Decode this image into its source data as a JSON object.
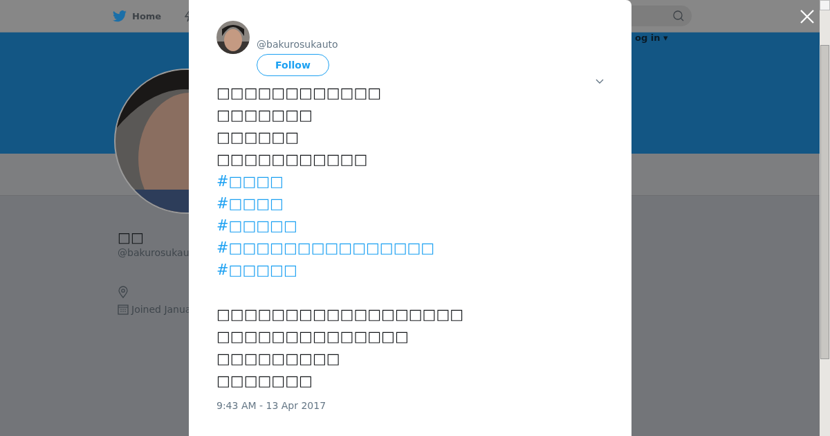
{
  "background_page": {
    "nav": {
      "home": "Home",
      "login": "og in ▾"
    },
    "profile": {
      "name": "□□",
      "handle": "@bakurosukau",
      "joined": "Joined Janua"
    }
  },
  "tweet_modal": {
    "author": {
      "handle": "@bakurosukauto",
      "follow": "Follow"
    },
    "lines": [
      {
        "kind": "text",
        "text": "□□□□□□□□□□□□"
      },
      {
        "kind": "text",
        "text": "□□□□□□□"
      },
      {
        "kind": "text",
        "text": "□□□□□□"
      },
      {
        "kind": "text",
        "text": "□□□□□□□□□□□"
      },
      {
        "kind": "hashtag",
        "text": "#□□□□"
      },
      {
        "kind": "hashtag",
        "text": "#□□□□"
      },
      {
        "kind": "hashtag",
        "text": "#□□□□□"
      },
      {
        "kind": "hashtag",
        "text": "#□□□□□□□□□□□□□□□"
      },
      {
        "kind": "hashtag",
        "text": "#□□□□□"
      },
      {
        "kind": "blank"
      },
      {
        "kind": "text",
        "text": "□□□□□□□□□□□□□□□□□□"
      },
      {
        "kind": "text",
        "text": "□□□□□□□□□□□□□□"
      },
      {
        "kind": "text",
        "text": "□□□□□□□□□"
      },
      {
        "kind": "text",
        "text": "□□□□□□□"
      }
    ],
    "timestamp": "9:43 AM - 13 Apr 2017"
  }
}
